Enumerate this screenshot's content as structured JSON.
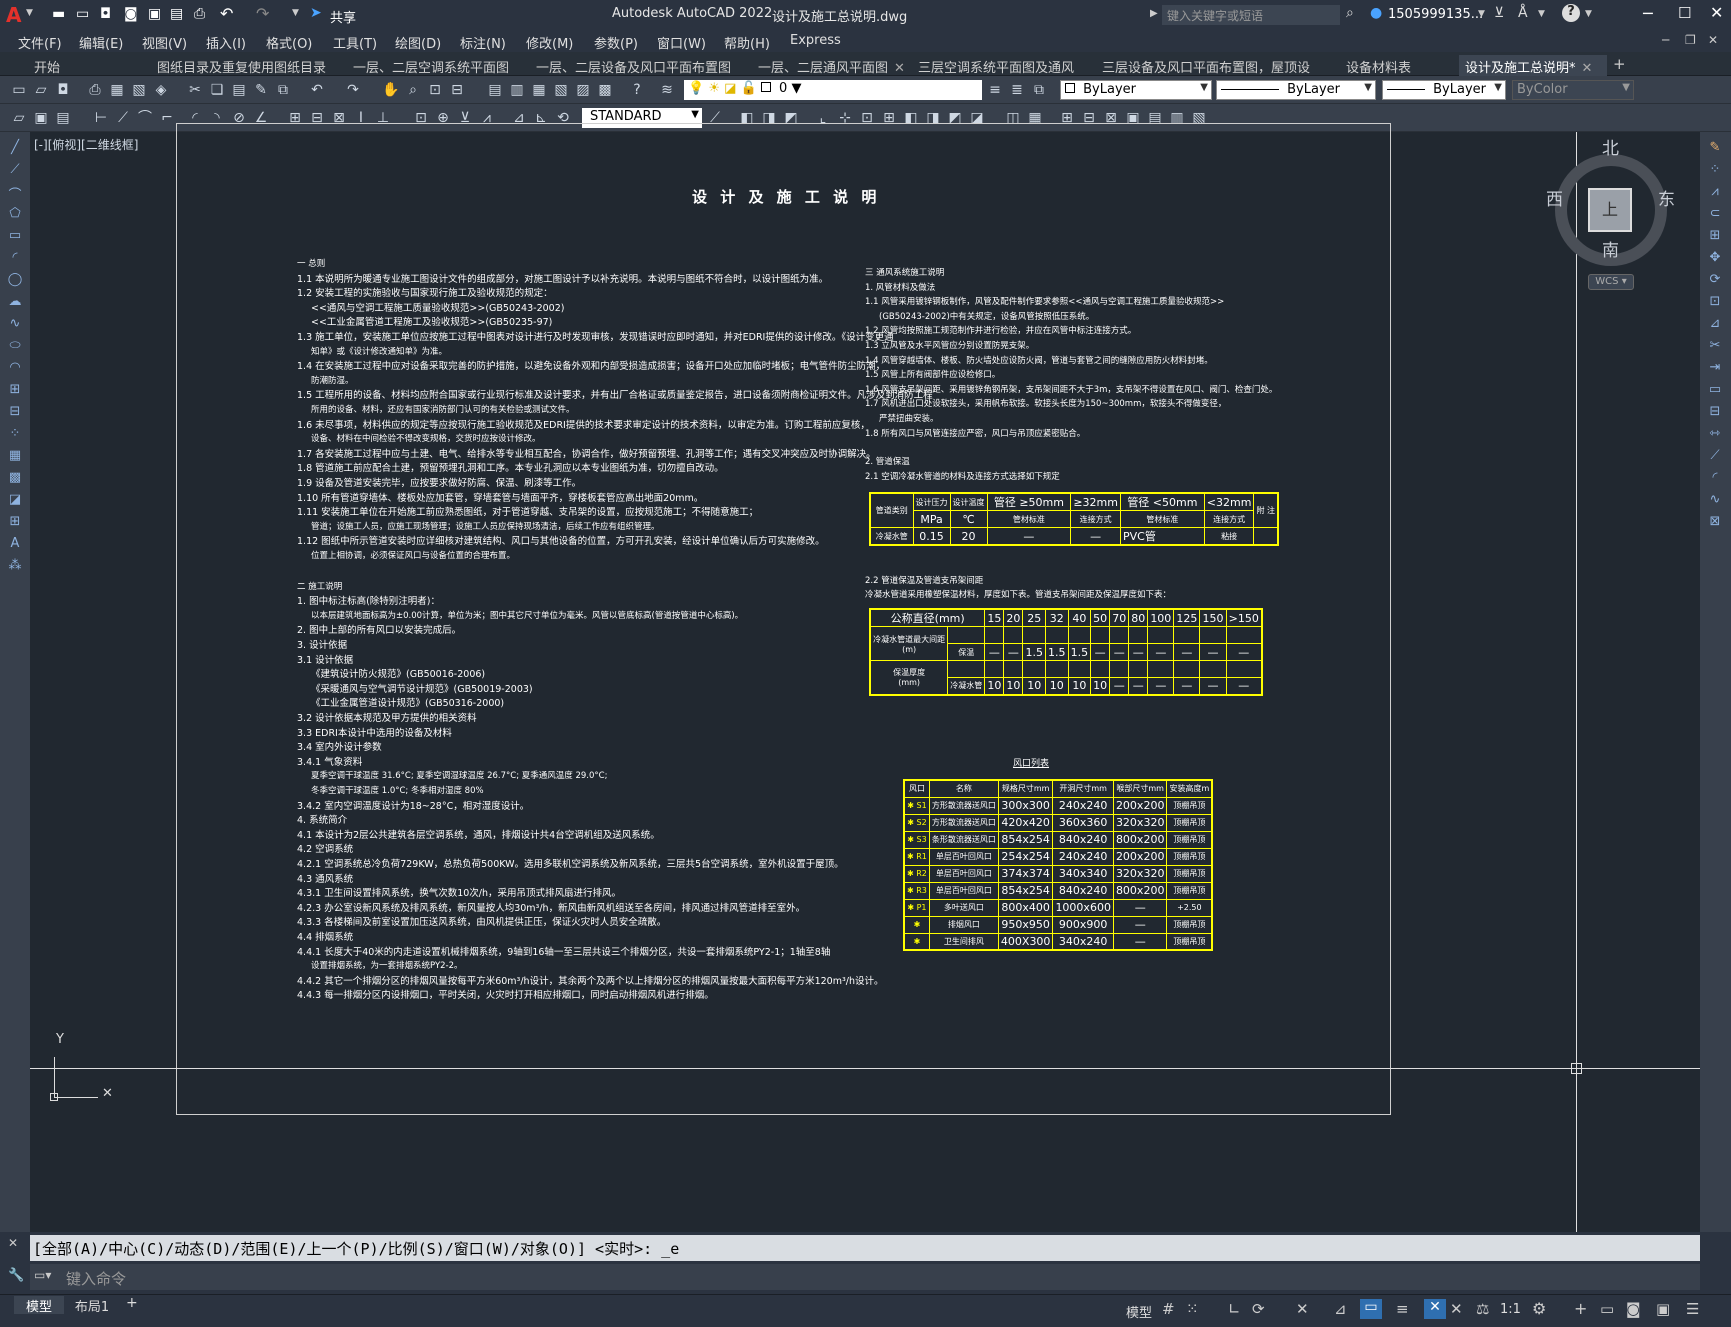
{
  "titlebar": {
    "app_title": "Autodesk AutoCAD 2022",
    "file_name": "设计及施工总说明.dwg",
    "share_label": "共享",
    "search_placeholder": "键入关键字或短语",
    "user_label": "1505999135...",
    "help_label": "?"
  },
  "menu": [
    "文件(F)",
    "编辑(E)",
    "视图(V)",
    "插入(I)",
    "格式(O)",
    "工具(T)",
    "绘图(D)",
    "标注(N)",
    "修改(M)",
    "参数(P)",
    "窗口(W)",
    "帮助(H)",
    "Express"
  ],
  "tabs": [
    {
      "label": "开始",
      "active": false
    },
    {
      "label": "图纸目录及重复使用图纸目录",
      "active": false
    },
    {
      "label": "一层、二层空调系统平面图",
      "active": false
    },
    {
      "label": "一层、二层设备及风口平面布置图",
      "active": false
    },
    {
      "label": "一层、二层通风平面图",
      "active": false
    },
    {
      "label": "三层空调系统平面图及通风",
      "active": false
    },
    {
      "label": "三层设备及风口平面布置图，屋顶设备",
      "active": false
    },
    {
      "label": "设备材料表",
      "active": false
    },
    {
      "label": "设计及施工总说明*",
      "active": true
    }
  ],
  "toolbar1": {
    "layer_value": "0",
    "color_value": "ByLayer",
    "linetype_value": "ByLayer",
    "lineweight_value": "ByLayer",
    "plotstyle_value": "ByColor"
  },
  "toolbar2": {
    "textstyle_value": "STANDARD"
  },
  "viewport_label": "[-][俯视][二维线框]",
  "viewcube": {
    "north": "北",
    "south": "南",
    "east": "东",
    "west": "西",
    "face": "上",
    "wcs": "WCS"
  },
  "drawing": {
    "title": "设 计 及 施 工 说 明",
    "left_lines": [
      "一 总则",
      "1.1 本说明所为暖通专业施工图设计文件的组成部分，对施工图设计予以补充说明。本说明与图纸不符合时，以设计图纸为准。",
      "1.2 安装工程的实施验收与国家现行施工及验收规范的规定：",
      "<<通风与空调工程施工质量验收规范>>(GB50243-2002)",
      "<<工业金属管道工程施工及验收规范>>(GB50235-97)",
      "1.3 施工单位，安装施工单位应按施工过程中图表对设计进行及时发现审核，发现错误时应即时通知，并对EDRI提供的设计修改。《设计变更通",
      "知单》或《设计修改通知单》为准。",
      "1.4 在安装施工过程中应对设备采取完善的防护措施，以避免设备外观和内部受损造成损害；设备开口处应加临时堵板；电气管件防尘防潮，",
      "防潮防湿。",
      "1.5 工程所用的设备、材料均应附合国家或行业现行标准及设计要求，并有出厂合格证或质量鉴定报告，进口设备须附商检证明文件。凡涉及到消防工程",
      "所用的设备、材料，还应有国家消防部门认可的有关检验或测试文件。",
      "1.6 未尽事项，材料供应的规定等应按现行施工验收规范及EDRI提供的技术要求审定设计的技术资料，以审定为准。订购工程前应复核，",
      "设备、材料在中间检验不得改变规格，交货时应按设计修改。",
      "1.7 各安装施工过程中应与土建、电气、给排水等专业相互配合，协调合作，做好预留预埋、孔洞等工作；遇有交叉冲突应及时协调解决。",
      "1.8 管道施工前应配合土建，预留预埋孔洞和工序。本专业孔洞应以本专业图纸为准，切勿擅自改动。",
      "1.9 设备及管道安装完毕，应按要求做好防腐、保温、刷漆等工作。",
      "1.10 所有管道穿墙体、楼板处应加套管，穿墙套管与墙面平齐，穿楼板套管应高出地面20mm。",
      "1.11 安装施工单位在开始施工前应熟悉图纸，对于管道穿越、支吊架的设置，应按规范施工；不得随意施工；",
      "管道；设施工人员，应施工现场管理；设施工人员应保持现场清洁，后续工作应有组织管理。",
      "1.12 图纸中所示管道安装时应详细核对建筑结构、风口与其他设备的位置，方可开孔安装，经设计单位确认后方可实施修改。",
      "位置上相协调，必须保证风口与设备位置的合理布置。",
      "二 施工说明",
      "1. 图中标注标高(除特别注明者)：",
      "以本层建筑地面标高为±0.00计算，单位为米；图中其它尺寸单位为毫米。风管以管底标高(管道按管道中心标高)。",
      "2. 图中上部的所有风口以安装完成后。",
      "3. 设计依据",
      "3.1 设计依据",
      "《建筑设计防火规范》(GB50016-2006)",
      "《采暖通风与空气调节设计规范》(GB50019-2003)",
      "《工业金属管道设计规范》(GB50316-2000)",
      "3.2 设计依据本规范及甲方提供的相关资料",
      "3.3 EDRI本设计中选用的设备及材料",
      "3.4 室内外设计参数",
      "3.4.1 气象资料",
      "夏季空调干球温度 31.6°C;   夏季空调湿球温度 26.7°C;   夏季通风温度 29.0°C;",
      "冬季空调干球温度 1.0°C;   冬季相对湿度 80%",
      "3.4.2 室内空调温度设计为18~28°C，相对湿度设计。",
      "4. 系统简介",
      "4.1 本设计为2层公共建筑各层空调系统，通风，排烟设计共4台空调机组及送风系统。",
      "4.2 空调系统",
      "4.2.1 空调系统总冷负荷729KW，总热负荷500KW。选用多联机空调系统及新风系统，三层共5台空调系统，室外机设置于屋顶。",
      "4.3 通风系统",
      "4.3.1 卫生间设置排风系统，换气次数10次/h，采用吊顶式排风扇进行排风。",
      "4.2.3 办公室设新风系统及排风系统，新风量按人均30m³/h，新风由新风机组送至各房间，排风通过排风管道排至室外。",
      "4.3.3 各楼梯间及前室设置加压送风系统，由风机提供正压，保证火灾时人员安全疏散。",
      "4.4 排烟系统",
      "4.4.1 长度大于40米的内走道设置机械排烟系统，9轴到16轴一至三层共设三个排烟分区，共设一套排烟系统PY2-1；1轴至8轴",
      "设置排烟系统，为一套排烟系统PY2-2。",
      "4.4.2 其它一个排烟分区的排烟风量按每平方米60m³/h设计，其余两个及两个以上排烟分区的排烟风量按最大面积每平方米120m³/h设计。",
      "4.4.3 每一排烟分区内设排烟口，平时关闭，火灾时打开相应排烟口，同时启动排烟风机进行排烟。"
    ],
    "right_lines": [
      "三 通风系统施工说明",
      "1. 风管材料及做法",
      "1.1 风管采用镀锌钢板制作，风管及配件制作要求参照<<通风与空调工程施工质量验收规范>>",
      "(GB50243-2002)中有关规定，设备风管按照低压系统。",
      "1.2 风管均按照施工规范制作并进行检验，并应在风管中标注连接方式。",
      "1.3 立风管及水平风管应分别设置防晃支架。",
      "1.4 风管穿越墙体、楼板、防火墙处应设防火阀，管道与套管之间的缝隙应用防火材料封堵。",
      "1.5 风管上所有阀部件应设检修口。",
      "1.6 风管支吊架间距、采用镀锌角钢吊架，支吊架间距不大于3m，支吊架不得设置在风口、阀门、检查门处。",
      "1.7 风机进出口处设软接头，采用帆布软接。软接头长度为150~300mm，软接头不得做变径，",
      "严禁扭曲安装。",
      "1.8 所有风口与风管连接应严密，风口与吊顶应紧密贴合。",
      "2. 管道保温",
      "2.1 空调冷凝水管道的材料及连接方式选择如下规定"
    ],
    "right_lines2": [
      "2.2 管道保温及管道支吊架间距",
      "冷凝水管道采用橡塑保温材料，厚度如下表。管道支吊架间距及保温厚度如下表："
    ],
    "pipe_table": {
      "header1": [
        "管道类别",
        "设计压力",
        "设计温度",
        "管径 ≥50mm",
        "≥32mm",
        "管径 <50mm",
        "<32mm",
        "附 注"
      ],
      "header2": [
        "",
        "MPa",
        "℃",
        "管材标准",
        "连接方式",
        "管材标准",
        "连接方式",
        ""
      ],
      "row": [
        "冷凝水管",
        "0.15",
        "20",
        "—",
        "—",
        "PVC管",
        "粘接",
        ""
      ]
    },
    "spacing_table": {
      "col_label": "公称直径(mm)",
      "diameters": [
        "15",
        "20",
        "25",
        "32",
        "40",
        "50",
        "70",
        "80",
        "100",
        "125",
        "150",
        ">150"
      ],
      "row1_label1": "冷凝水管道最大间距",
      "row1_label2": "(m)",
      "row1_sub": "保温",
      "row1_values": [
        "—",
        "—",
        "1.5",
        "1.5",
        "1.5",
        "—",
        "—",
        "—",
        "—",
        "—",
        "—",
        "—"
      ],
      "row2_label1": "保温厚度",
      "row2_label2": "(mm)",
      "row2_sub": "冷凝水管",
      "row2_values": [
        "10",
        "10",
        "10",
        "10",
        "10",
        "10",
        "—",
        "—",
        "—",
        "—",
        "—",
        "—"
      ]
    },
    "vent_table": {
      "title": "风口列表",
      "headers": [
        "风口",
        "名称",
        "规格尺寸mm",
        "开洞尺寸mm",
        "喉部尺寸mm",
        "安装高度m"
      ],
      "rows": [
        [
          "S1",
          "方形散流器送风口",
          "300x300",
          "240x240",
          "200x200",
          "顶棚吊顶"
        ],
        [
          "S2",
          "方形散流器送风口",
          "420x420",
          "360x360",
          "320x320",
          "顶棚吊顶"
        ],
        [
          "S3",
          "条形散流器送风口",
          "854x254",
          "840x240",
          "800x200",
          "顶棚吊顶"
        ],
        [
          "R1",
          "单层百叶回风口",
          "254x254",
          "240x240",
          "200x200",
          "顶棚吊顶"
        ],
        [
          "R2",
          "单层百叶回风口",
          "374x374",
          "340x340",
          "320x320",
          "顶棚吊顶"
        ],
        [
          "R3",
          "单层百叶回风口",
          "854x254",
          "840x240",
          "800x200",
          "顶棚吊顶"
        ],
        [
          "P1",
          "多叶送风口",
          "800x400",
          "1000x600",
          "—",
          "+2.50"
        ],
        [
          "",
          "排烟风口",
          "950x950",
          "900x900",
          "—",
          "顶棚吊顶"
        ],
        [
          "",
          "卫生间排风",
          "400X300",
          "340x240",
          "—",
          "顶棚吊顶"
        ]
      ]
    }
  },
  "command": {
    "history": "[全部(A)/中心(C)/动态(D)/范围(E)/上一个(P)/比例(S)/窗口(W)/对象(O)] <实时>: _e",
    "placeholder": "键入命令"
  },
  "status": {
    "tab_model": "模型",
    "tab_layout": "布局1",
    "model_label": "模型",
    "scale_label": "1:1"
  }
}
